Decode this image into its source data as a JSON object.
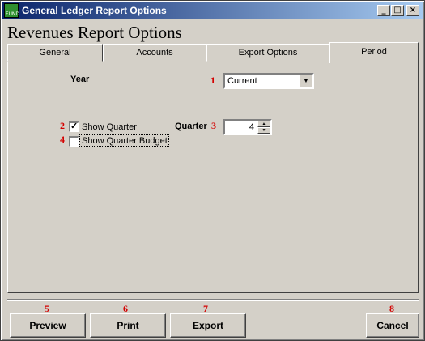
{
  "window": {
    "title": "General Ledger Report Options",
    "app_icon_text": "FUND",
    "minimize": "_",
    "maximize": "□",
    "close": "×"
  },
  "heading": "Revenues Report Options",
  "tabs": [
    {
      "label": "General"
    },
    {
      "label": "Accounts"
    },
    {
      "label": "Export Options"
    },
    {
      "label": "Period",
      "active": true
    }
  ],
  "period": {
    "year_label": "Year",
    "year_value": "Current",
    "show_quarter_label": "Show Quarter",
    "show_quarter_checked": true,
    "show_quarter_budget_label": "Show Quarter Budget",
    "show_quarter_budget_checked": false,
    "quarter_label": "Quarter",
    "quarter_value": "4"
  },
  "markers": [
    "1",
    "2",
    "3",
    "4",
    "5",
    "6",
    "7",
    "8"
  ],
  "buttons": {
    "preview": "Preview",
    "print": "Print",
    "export": "Export",
    "cancel": "Cancel"
  },
  "colors": {
    "titlebar_start": "#0a246a",
    "titlebar_end": "#a6caf0",
    "marker": "#d40000",
    "face": "#d4d0c8"
  }
}
